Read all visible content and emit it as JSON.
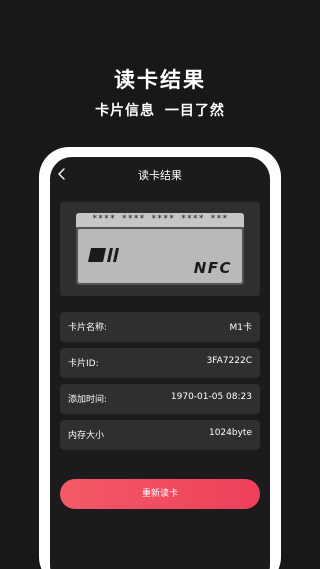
{
  "promo": {
    "title": "读卡结果",
    "subtitle": "卡片信息 一目了然"
  },
  "nav": {
    "title": "读卡结果",
    "back_icon": "chevron-left-icon"
  },
  "card": {
    "number": "**** **** **** **** ***",
    "badge": "NFC",
    "chip_icon": "card-stripes-icon"
  },
  "info": {
    "rows": [
      {
        "label": "卡片名称:",
        "value": "M1卡"
      },
      {
        "label": "卡片ID:",
        "value": "3FA7222C"
      },
      {
        "label": "添加时间:",
        "value": "1970-01-05 08:23"
      },
      {
        "label": "内存大小",
        "value": "1024byte"
      }
    ]
  },
  "actions": {
    "reread_label": "重新读卡"
  },
  "colors": {
    "background": "#18181a",
    "panel": "#2f2f31",
    "accent_start": "#f45a66",
    "accent_end": "#ee3f5a"
  }
}
